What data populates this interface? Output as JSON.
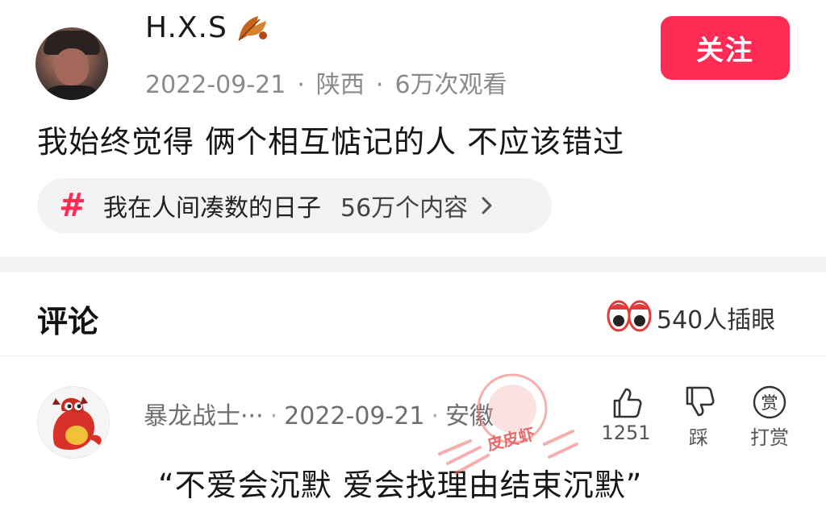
{
  "post": {
    "username": "H.X.S",
    "date": "2022-09-21",
    "location": "陕西",
    "views": "6万次观看",
    "follow_label": "关注",
    "caption": "我始终觉得 俩个相互惦记的人 不应该错过",
    "topic": {
      "name": "我在人间凑数的日子",
      "count": "56万个内容"
    }
  },
  "comments_section": {
    "title": "评论",
    "watchers": "540人插眼"
  },
  "comment": {
    "username": "暴龙战士···",
    "date": "2022-09-21",
    "location": "安徽",
    "text": "“不爱会沉默  爱会找理由结束沉默”",
    "like_count": "1251",
    "dislike_label": "踩",
    "tip_label": "打赏",
    "tip_icon_text": "赏"
  },
  "watermark": {
    "text": "皮皮虾"
  },
  "colors": {
    "accent": "#fe2c55",
    "meta_gray": "#8a8a8a",
    "chip_bg": "#f3f3f5"
  },
  "icons": [
    "leaf-icon",
    "hash-icon",
    "chevron-right-icon",
    "eyes-icon",
    "thumbs-up-icon",
    "thumbs-down-icon",
    "tip-icon"
  ]
}
